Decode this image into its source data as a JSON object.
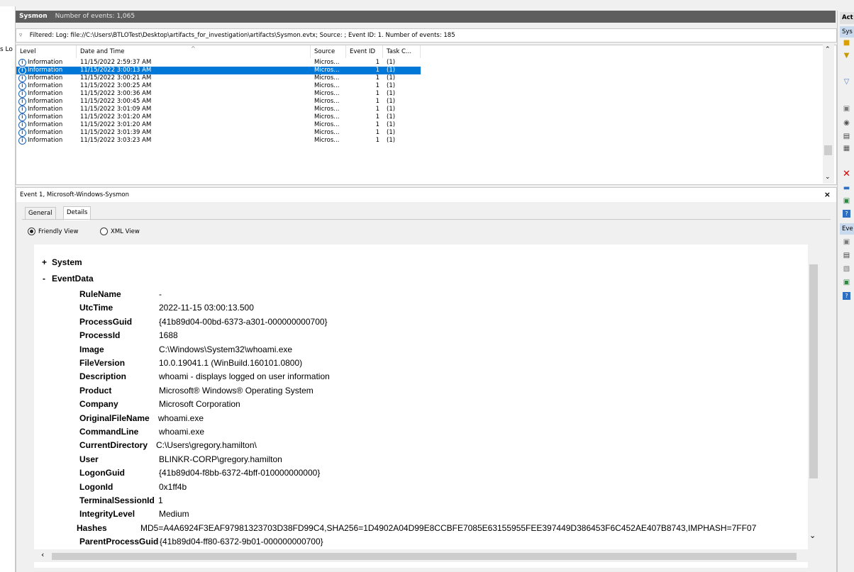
{
  "left_panel": {
    "truncated_text": "s Lo"
  },
  "log": {
    "name": "Sysmon",
    "count_text": "Number of events: 1,065",
    "filter_text": "Filtered: Log: file://C:\\Users\\BTLOTest\\Desktop\\artifacts_for_investigation\\artifacts\\Sysmon.evtx; Source: ; Event ID: 1. Number of events: 185"
  },
  "columns": {
    "level": "Level",
    "date": "Date and Time",
    "source": "Source",
    "event_id": "Event ID",
    "task": "Task C..."
  },
  "rows": [
    {
      "level": "Information",
      "date": "11/15/2022 2:59:37 AM",
      "source": "Micros...",
      "id": "1",
      "task": "(1)"
    },
    {
      "level": "Information",
      "date": "11/15/2022 3:00:13 AM",
      "source": "Micros...",
      "id": "1",
      "task": "(1)"
    },
    {
      "level": "Information",
      "date": "11/15/2022 3:00:21 AM",
      "source": "Micros...",
      "id": "1",
      "task": "(1)"
    },
    {
      "level": "Information",
      "date": "11/15/2022 3:00:25 AM",
      "source": "Micros...",
      "id": "1",
      "task": "(1)"
    },
    {
      "level": "Information",
      "date": "11/15/2022 3:00:36 AM",
      "source": "Micros...",
      "id": "1",
      "task": "(1)"
    },
    {
      "level": "Information",
      "date": "11/15/2022 3:00:45 AM",
      "source": "Micros...",
      "id": "1",
      "task": "(1)"
    },
    {
      "level": "Information",
      "date": "11/15/2022 3:01:09 AM",
      "source": "Micros...",
      "id": "1",
      "task": "(1)"
    },
    {
      "level": "Information",
      "date": "11/15/2022 3:01:20 AM",
      "source": "Micros...",
      "id": "1",
      "task": "(1)"
    },
    {
      "level": "Information",
      "date": "11/15/2022 3:01:20 AM",
      "source": "Micros...",
      "id": "1",
      "task": "(1)"
    },
    {
      "level": "Information",
      "date": "11/15/2022 3:01:39 AM",
      "source": "Micros...",
      "id": "1",
      "task": "(1)"
    },
    {
      "level": "Information",
      "date": "11/15/2022 3:03:23 AM",
      "source": "Micros...",
      "id": "1",
      "task": "(1)"
    }
  ],
  "selected_row_index": 1,
  "details": {
    "title": "Event 1, Microsoft-Windows-Sysmon",
    "close": "×",
    "tab_general": "General",
    "tab_details": "Details",
    "radio_friendly": "Friendly View",
    "radio_xml": "XML View",
    "system_toggle": "+",
    "system_label": "System",
    "eventdata_toggle": "-",
    "eventdata_label": "EventData",
    "fields": [
      {
        "k": "RuleName",
        "v": "-"
      },
      {
        "k": "UtcTime",
        "v": "2022-11-15 03:00:13.500"
      },
      {
        "k": "ProcessGuid",
        "v": "{41b89d04-00bd-6373-a301-000000000700}"
      },
      {
        "k": "ProcessId",
        "v": "1688"
      },
      {
        "k": "Image",
        "v": "C:\\Windows\\System32\\whoami.exe"
      },
      {
        "k": "FileVersion",
        "v": "10.0.19041.1 (WinBuild.160101.0800)"
      },
      {
        "k": "Description",
        "v": "whoami - displays logged on user information"
      },
      {
        "k": "Product",
        "v": "Microsoft® Windows® Operating System"
      },
      {
        "k": "Company",
        "v": "Microsoft Corporation"
      },
      {
        "k": "OriginalFileName",
        "v": "whoami.exe"
      },
      {
        "k": "CommandLine",
        "v": "whoami.exe"
      },
      {
        "k": "CurrentDirectory",
        "v": "C:\\Users\\gregory.hamilton\\"
      },
      {
        "k": "User",
        "v": "BLINKR-CORP\\gregory.hamilton"
      },
      {
        "k": "LogonGuid",
        "v": "{41b89d04-f8bb-6372-4bff-010000000000}"
      },
      {
        "k": "LogonId",
        "v": "0x1ff4b"
      },
      {
        "k": "TerminalSessionId",
        "v": "1"
      },
      {
        "k": "IntegrityLevel",
        "v": "Medium"
      },
      {
        "k": "Hashes",
        "v": "MD5=A4A6924F3EAF97981323703D38FD99C4,SHA256=1D4902A04D99E8CCBFE7085E63155955FEE397449D386453F6C452AE407B8743,IMPHASH=7FF07"
      },
      {
        "k": "ParentProcessGuid",
        "v": "{41b89d04-ff80-6372-9b01-000000000700}"
      }
    ]
  },
  "actions": {
    "header": "Act",
    "sub1": "Sys",
    "sub2": "Eve"
  },
  "colors": {
    "selection": "#0078d7",
    "header_bg": "#5e5e5e"
  }
}
